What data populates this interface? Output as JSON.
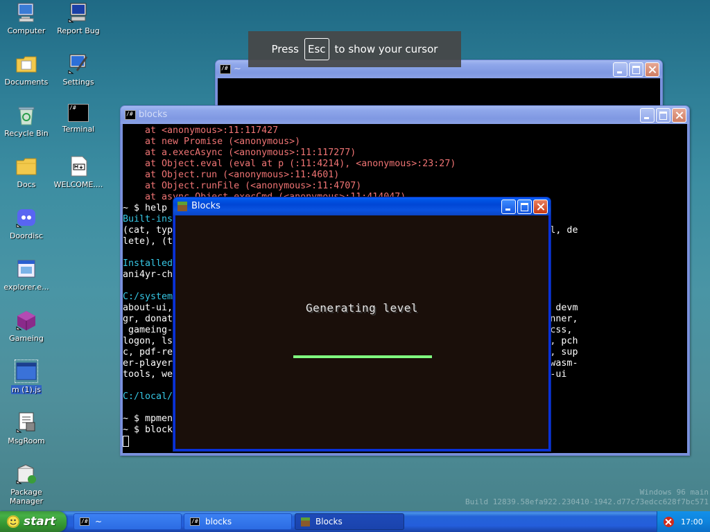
{
  "desktop": {
    "icons": [
      {
        "label": "Computer",
        "icon": "computer-icon"
      },
      {
        "label": "Report Bug",
        "icon": "report-bug-icon"
      },
      {
        "label": "Documents",
        "icon": "documents-folder-icon"
      },
      {
        "label": "Settings",
        "icon": "settings-icon"
      },
      {
        "label": "Recycle Bin",
        "icon": "recycle-bin-icon"
      },
      {
        "label": "Terminal",
        "icon": "terminal-icon"
      },
      {
        "label": "Docs",
        "icon": "folder-icon"
      },
      {
        "label": "WELCOME....",
        "icon": "markdown-file-icon"
      },
      {
        "label": "Doordisc",
        "icon": "discord-icon"
      },
      {
        "label": "explorer.e...",
        "icon": "executable-icon"
      },
      {
        "label": "Gameing",
        "icon": "cube-icon"
      },
      {
        "label": "m (1).js",
        "icon": "window-file-icon"
      },
      {
        "label": "MsgRoom",
        "icon": "msgroom-icon"
      },
      {
        "label": "Package Manager",
        "icon": "package-manager-icon"
      }
    ]
  },
  "toast": {
    "prefix": "Press",
    "key": "Esc",
    "suffix": "to show your cursor"
  },
  "windows": {
    "back_terminal": {
      "title": "~"
    },
    "terminal": {
      "title": "blocks",
      "lines": [
        {
          "t": "    at <anonymous>:11:117427",
          "c": "err"
        },
        {
          "t": "    at new Promise (<anonymous>)",
          "c": "err"
        },
        {
          "t": "    at a.execAsync (<anonymous>:11:117277)",
          "c": "err"
        },
        {
          "t": "    at Object.eval (eval at p (:11:4214), <anonymous>:23:27)",
          "c": "err"
        },
        {
          "t": "    at Object.run (<anonymous>:11:4601)",
          "c": "err"
        },
        {
          "t": "    at Object.runFile (<anonymous>:11:4707)",
          "c": "err"
        },
        {
          "t": "    at async Object.execCmd (<anonymous>:11:414047)",
          "c": "err"
        },
        {
          "t": "~ $ help",
          "c": ""
        },
        {
          "t": "Built-ins",
          "c": "cy"
        },
        {
          "t": "(cat, typ                                                  nv, move), (rm, del, de",
          "c": ""
        },
        {
          "t": "lete), (t",
          "c": ""
        },
        {
          "t": "",
          "c": ""
        },
        {
          "t": "Installed",
          "c": "cy"
        },
        {
          "t": "ani4yr-ch",
          "c": ""
        },
        {
          "t": "",
          "c": ""
        },
        {
          "t": "C:/system",
          "c": "cy"
        },
        {
          "t": "about-ui,                                                  , credits, devenv, devm",
          "c": ""
        },
        {
          "t": "gr, donat                                                  ameing, gameing-runner,",
          "c": ""
        },
        {
          "t": " gameing-                                                  , jsh, linux, livecss,",
          "c": ""
        },
        {
          "t": "logon, ls                                                   openurl, openwith, pch",
          "c": ""
        },
        {
          "t": "c, pdf-re                                                  hareboard, shell36, sup",
          "c": ""
        },
        {
          "t": "er-player                                                  ader, verbrowser, wasm-",
          "c": ""
        },
        {
          "t": "tools, we                                                  quare, zip-mounter-ui",
          "c": ""
        },
        {
          "t": "",
          "c": ""
        },
        {
          "t": "C:/local/",
          "c": "cy"
        },
        {
          "t": "",
          "c": ""
        },
        {
          "t": "~ $ mpmen",
          "c": ""
        },
        {
          "t": "~ $ block",
          "c": ""
        }
      ]
    },
    "blocks": {
      "title": "Blocks",
      "status": "Generating level",
      "progress": 1.0,
      "progress_color": "#80ff80"
    }
  },
  "watermark": {
    "line1": "Windows 96 main",
    "line2": "Build 12839.58efa922.230410-1942.d77c73edcc628f7bc571"
  },
  "taskbar": {
    "start_label": "start",
    "tasks": [
      {
        "label": "~",
        "icon": "terminal-icon"
      },
      {
        "label": "blocks",
        "icon": "terminal-icon"
      },
      {
        "label": "Blocks",
        "icon": "grass-block-icon"
      }
    ],
    "clock": "17:00"
  }
}
